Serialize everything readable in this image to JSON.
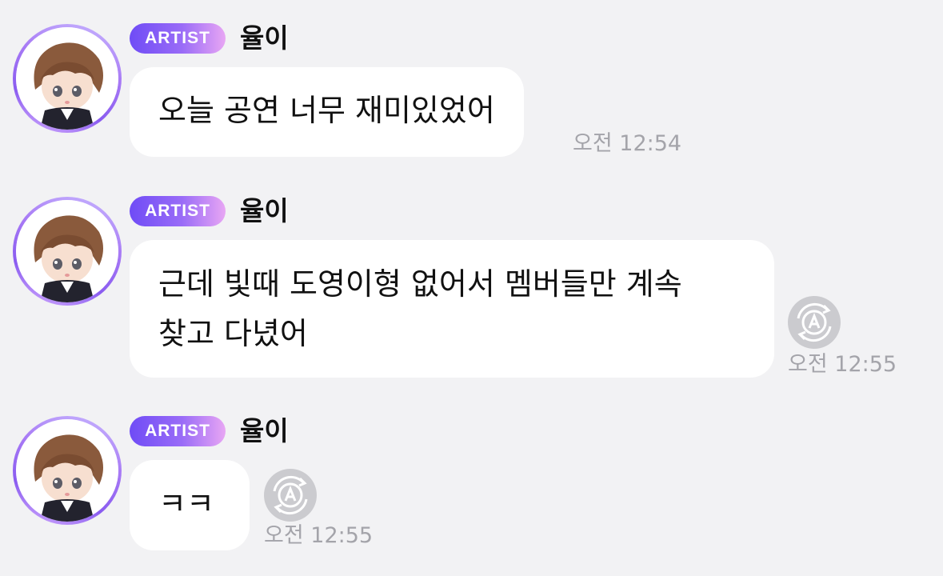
{
  "messages": [
    {
      "badge": "ARTIST",
      "sender": "율이",
      "text_lines": [
        "오늘 공연 너무 재미있었어"
      ],
      "time": "오전 12:54",
      "translate_icon": false
    },
    {
      "badge": "ARTIST",
      "sender": "율이",
      "text_lines": [
        "근데 빛때 도영이형 없어서 멤버들만 계속",
        "찾고 다녔어"
      ],
      "time": "오전 12:55",
      "translate_icon": true
    },
    {
      "badge": "ARTIST",
      "sender": "율이",
      "text_lines": [
        "ㅋㅋ"
      ],
      "time": "오전 12:55",
      "translate_icon": true
    }
  ],
  "colors": {
    "background": "#f2f2f4",
    "bubble": "#ffffff",
    "badge_gradient_start": "#6f4cf6",
    "badge_gradient_end": "#e8a6f4",
    "timestamp": "#a4a4aa",
    "translate_button": "#cbcbcf"
  },
  "icons": {
    "avatar": "chibi-character-avatar-icon",
    "translate": "auto-translate-icon"
  }
}
